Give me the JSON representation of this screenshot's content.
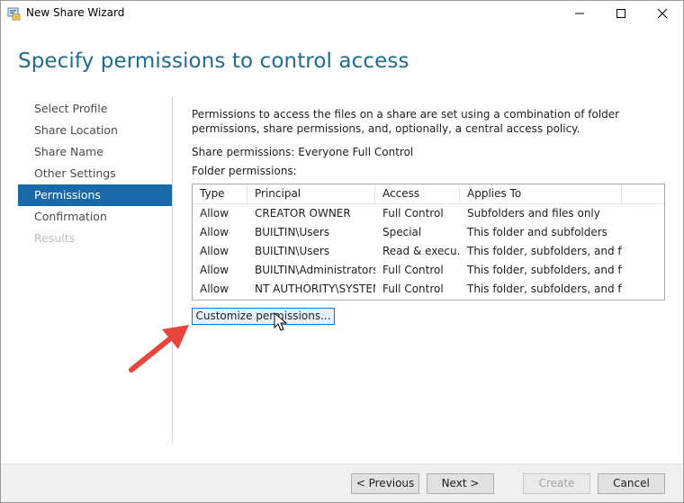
{
  "window": {
    "title": "New Share Wizard"
  },
  "header": {
    "title": "Specify permissions to control access"
  },
  "nav": {
    "items": [
      {
        "label": "Select Profile",
        "state": "normal"
      },
      {
        "label": "Share Location",
        "state": "normal"
      },
      {
        "label": "Share Name",
        "state": "normal"
      },
      {
        "label": "Other Settings",
        "state": "normal"
      },
      {
        "label": "Permissions",
        "state": "active"
      },
      {
        "label": "Confirmation",
        "state": "normal"
      },
      {
        "label": "Results",
        "state": "disabled"
      }
    ]
  },
  "content": {
    "description": "Permissions to access the files on a share are set using a combination of folder permissions, share permissions, and, optionally, a central access policy.",
    "share_permissions_label": "Share permissions:",
    "share_permissions_value": "Everyone Full Control",
    "folder_permissions_label": "Folder permissions:",
    "table": {
      "columns": [
        "Type",
        "Principal",
        "Access",
        "Applies To"
      ],
      "rows": [
        [
          "Allow",
          "CREATOR OWNER",
          "Full Control",
          "Subfolders and files only"
        ],
        [
          "Allow",
          "BUILTIN\\Users",
          "Special",
          "This folder and subfolders"
        ],
        [
          "Allow",
          "BUILTIN\\Users",
          "Read & execu...",
          "This folder, subfolders, and files"
        ],
        [
          "Allow",
          "BUILTIN\\Administrators",
          "Full Control",
          "This folder, subfolders, and files"
        ],
        [
          "Allow",
          "NT AUTHORITY\\SYSTEM",
          "Full Control",
          "This folder, subfolders, and files"
        ]
      ]
    },
    "customize_label": "Customize permissions..."
  },
  "footer": {
    "previous_label": "< Previous",
    "next_label": "Next >",
    "create_label": "Create",
    "cancel_label": "Cancel"
  },
  "colors": {
    "title_blue": "#1e6c8e",
    "nav_active": "#1769aa",
    "annotation_arrow": "#e8453c"
  },
  "icons": {
    "app": "share-wizard-icon",
    "minimize": "minimize-icon",
    "maximize": "maximize-icon",
    "close": "close-icon",
    "annotation": "red-arrow-icon",
    "cursor": "mouse-pointer-icon"
  }
}
